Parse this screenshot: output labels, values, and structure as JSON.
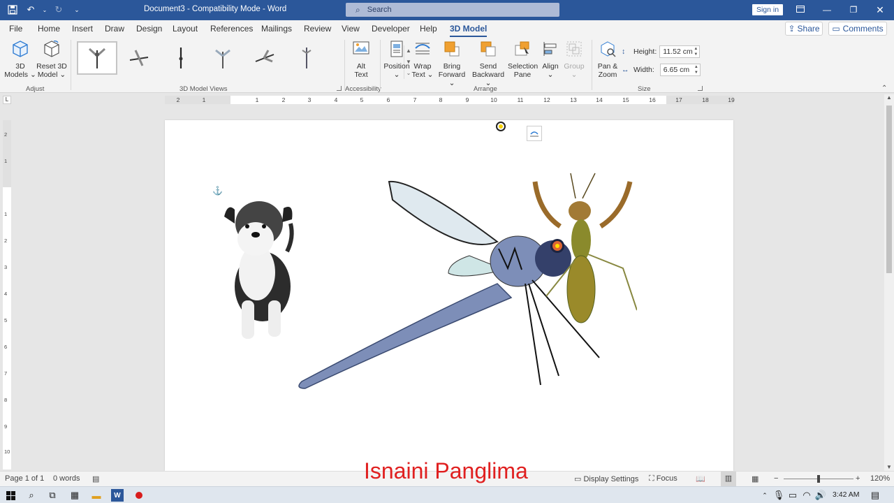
{
  "titlebar": {
    "doc_title": "Document3  -  Compatibility Mode  -  Word",
    "search_placeholder": "Search",
    "signin_label": "Sign in"
  },
  "tabs": [
    "File",
    "Home",
    "Insert",
    "Draw",
    "Design",
    "Layout",
    "References",
    "Mailings",
    "Review",
    "View",
    "Developer",
    "Help",
    "3D Model"
  ],
  "active_tab": "3D Model",
  "share_label": "Share",
  "comments_label": "Comments",
  "ribbon": {
    "adjust": {
      "models_l1": "3D",
      "models_l2": "Models",
      "reset_l1": "Reset 3D",
      "reset_l2": "Model",
      "label": "Adjust"
    },
    "views_label": "3D Model Views",
    "alttext_l1": "Alt",
    "alttext_l2": "Text",
    "accessibility_label": "Accessibility",
    "position_label": "Position",
    "wrap_l1": "Wrap",
    "wrap_l2": "Text",
    "bring_l1": "Bring",
    "bring_l2": "Forward",
    "send_l1": "Send",
    "send_l2": "Backward",
    "selpane_l1": "Selection",
    "selpane_l2": "Pane",
    "align_label": "Align",
    "group_label": "Group",
    "arrange_label": "Arrange",
    "pan_l1": "Pan &",
    "pan_l2": "Zoom",
    "height_label": "Height:",
    "height_value": "11.52 cm",
    "width_label": "Width:",
    "width_value": "6.65 cm",
    "size_label": "Size"
  },
  "status": {
    "page": "Page 1 of 1",
    "words": "0 words",
    "display_settings": "Display Settings",
    "focus": "Focus",
    "zoom": "120%"
  },
  "watermark": "Isnaini Panglima",
  "clock": "3:42 AM",
  "colors": {
    "word_blue": "#2b579a",
    "accent_orange": "#f0a030"
  }
}
